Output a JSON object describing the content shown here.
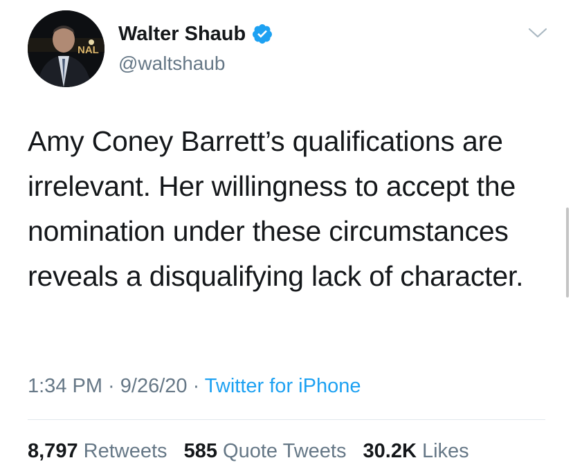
{
  "user": {
    "display_name": "Walter Shaub",
    "handle": "@waltshaub",
    "verified": true,
    "verified_color": "#1da1f2",
    "avatar_icon": "profile-photo"
  },
  "tweet": {
    "text": "Amy Coney Barrett’s qualifications are irrelevant. Her willingness to accept the nomination under these circumstances reveals a disqualifying lack of character."
  },
  "meta": {
    "time": "1:34 PM",
    "sep1": " · ",
    "date": "9/26/20",
    "sep2": " · ",
    "source": "Twitter for iPhone"
  },
  "stats": {
    "retweets_count": "8,797",
    "retweets_label": "Retweets",
    "quotes_count": "585",
    "quotes_label": "Quote Tweets",
    "likes_count": "30.2K",
    "likes_label": "Likes"
  },
  "icons": {
    "menu": "chevron-down-icon",
    "badge": "verified-badge-icon"
  }
}
